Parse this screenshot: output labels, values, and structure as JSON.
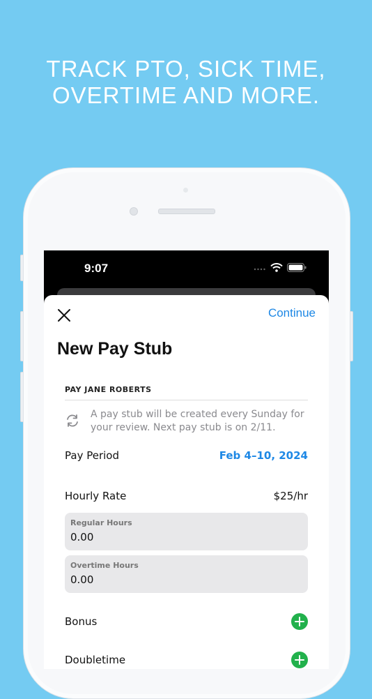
{
  "headline": {
    "line1": "TRACK PTO, SICK TIME,",
    "line2": "OVERTIME AND MORE."
  },
  "status_bar": {
    "time": "9:07",
    "icons": [
      "signal-icon",
      "wifi-icon",
      "battery-icon"
    ]
  },
  "sheet": {
    "close_icon": "close-icon",
    "continue_label": "Continue",
    "title": "New Pay Stub",
    "section_header": "PAY JANE ROBERTS",
    "info_icon": "repeat-icon",
    "info_text": "A pay stub will be created every Sunday for your review. Next pay stub is on 2/11.",
    "pay_period": {
      "label": "Pay Period",
      "value": "Feb 4–10, 2024"
    },
    "hourly_rate": {
      "label": "Hourly Rate",
      "value": "$25/hr"
    },
    "regular_hours": {
      "label": "Regular Hours",
      "value": "0.00"
    },
    "overtime_hours": {
      "label": "Overtime Hours",
      "value": "0.00"
    },
    "bonus": {
      "label": "Bonus"
    },
    "doubletime": {
      "label": "Doubletime"
    }
  },
  "colors": {
    "background": "#74CBF2",
    "accent": "#1E88E5",
    "add_button": "#22B14C"
  }
}
